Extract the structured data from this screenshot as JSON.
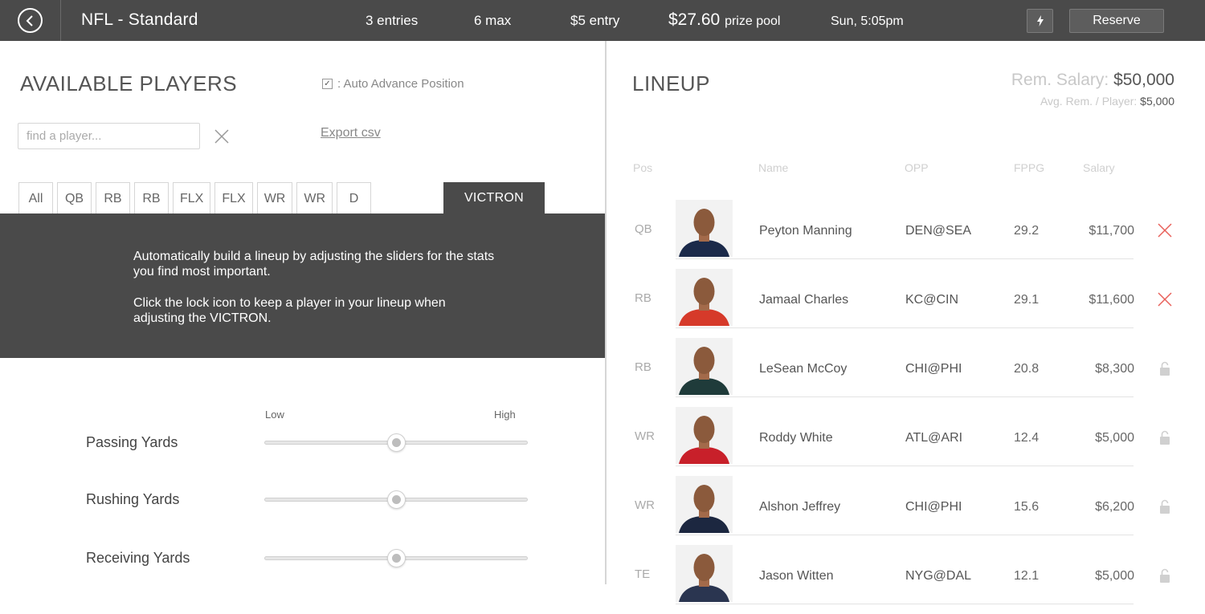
{
  "topbar": {
    "contest_title": "NFL - Standard",
    "entries": "3 entries",
    "max": "6 max",
    "entry_fee": "$5 entry",
    "prize_amount": "$27.60",
    "prize_label": "prize pool",
    "start_time": "Sun, 5:05pm",
    "reserve_label": "Reserve",
    "icons": {
      "back": "back-arrow-icon",
      "bolt": "lightning-bolt-icon"
    }
  },
  "available": {
    "title": "AVAILABLE PLAYERS",
    "auto_advance_label": ": Auto Advance Position",
    "auto_advance_checked": true,
    "search_placeholder": "find a player...",
    "export_label": "Export csv",
    "position_tabs": [
      "All",
      "QB",
      "RB",
      "RB",
      "FLX",
      "FLX",
      "WR",
      "WR",
      "D"
    ],
    "victron_tab": "VICTRON",
    "victron_text_1": "Automatically build a lineup by adjusting the sliders for the stats you find most important.",
    "victron_text_2": "Click the lock icon to keep a player in your lineup when adjusting the VICTRON.",
    "slider_low": "Low",
    "slider_high": "High",
    "sliders": [
      {
        "label": "Passing Yards",
        "level": 0.5
      },
      {
        "label": "Rushing Yards",
        "level": 0.5
      },
      {
        "label": "Receiving Yards",
        "level": 0.5
      }
    ]
  },
  "lineup": {
    "title": "LINEUP",
    "rem_salary_label": "Rem. Salary:",
    "rem_salary_value": "$50,000",
    "avg_rem_label": "Avg. Rem. / Player:",
    "avg_rem_value": "$5,000",
    "columns": {
      "pos": "Pos",
      "name": "Name",
      "opp": "OPP",
      "fppg": "FPPG",
      "salary": "Salary"
    },
    "rows": [
      {
        "pos": "QB",
        "name": "Peyton Manning",
        "opp": "DEN@SEA",
        "fppg": "29.2",
        "salary": "$11,700",
        "action": "remove",
        "jersey": "#1b2a4a"
      },
      {
        "pos": "RB",
        "name": "Jamaal Charles",
        "opp": "KC@CIN",
        "fppg": "29.1",
        "salary": "$11,600",
        "action": "remove",
        "jersey": "#d63a2a"
      },
      {
        "pos": "RB",
        "name": "LeSean McCoy",
        "opp": "CHI@PHI",
        "fppg": "20.8",
        "salary": "$8,300",
        "action": "lock",
        "jersey": "#1f3b3a"
      },
      {
        "pos": "WR",
        "name": "Roddy White",
        "opp": "ATL@ARI",
        "fppg": "12.4",
        "salary": "$5,000",
        "action": "lock",
        "jersey": "#c8202a"
      },
      {
        "pos": "WR",
        "name": "Alshon Jeffrey",
        "opp": "CHI@PHI",
        "fppg": "15.6",
        "salary": "$6,200",
        "action": "lock",
        "jersey": "#1c2740"
      },
      {
        "pos": "TE",
        "name": "Jason Witten",
        "opp": "NYG@DAL",
        "fppg": "12.1",
        "salary": "$5,000",
        "action": "lock",
        "jersey": "#2a3550"
      }
    ]
  },
  "colors": {
    "topbar": "#4a4a4a",
    "remove_red": "#e8605a",
    "lock_gray": "#d0d0d0"
  }
}
